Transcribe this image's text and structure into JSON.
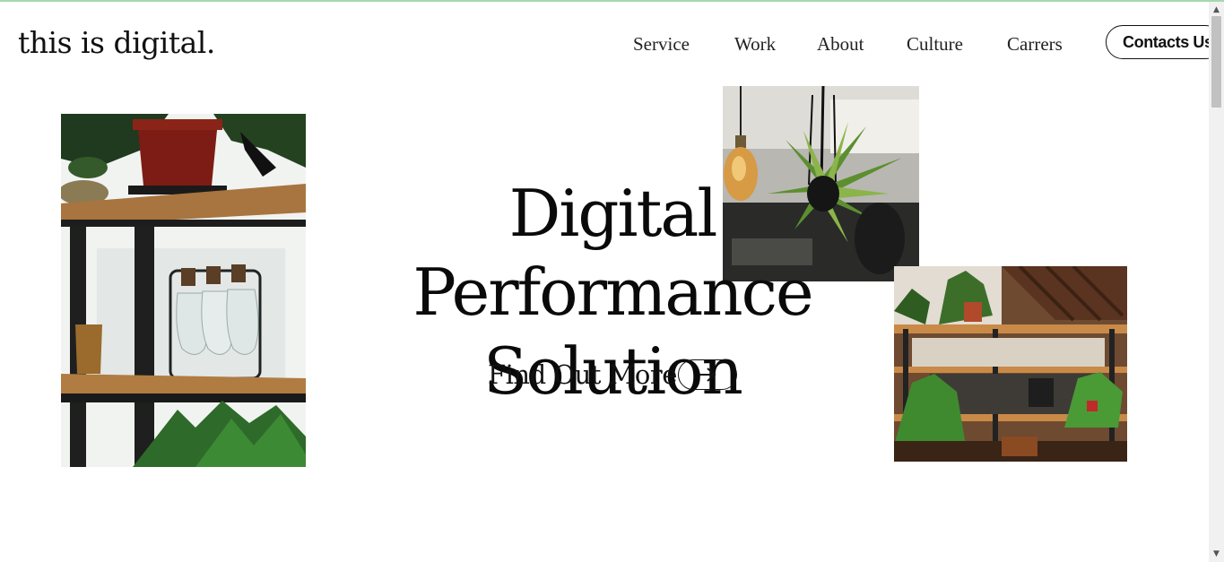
{
  "header": {
    "logo": "this is digital.",
    "nav": [
      {
        "label": "Service"
      },
      {
        "label": "Work"
      },
      {
        "label": "About"
      },
      {
        "label": "Culture"
      },
      {
        "label": "Carrers"
      }
    ],
    "contact_label": "Contacts Us"
  },
  "hero": {
    "title_line1": "Digital Performance",
    "title_line2": "Solution",
    "cta_label": "Find Out More",
    "cta_icon": "arrow-right-icon"
  },
  "images": {
    "left": "shelf-with-plants-and-glass-bottles",
    "top_right": "hanging-plant-and-edison-bulb",
    "bottom_right": "office-shelves-with-plants"
  },
  "colors": {
    "accent_line": "#a7d8ae",
    "text": "#111111",
    "background": "#ffffff"
  }
}
